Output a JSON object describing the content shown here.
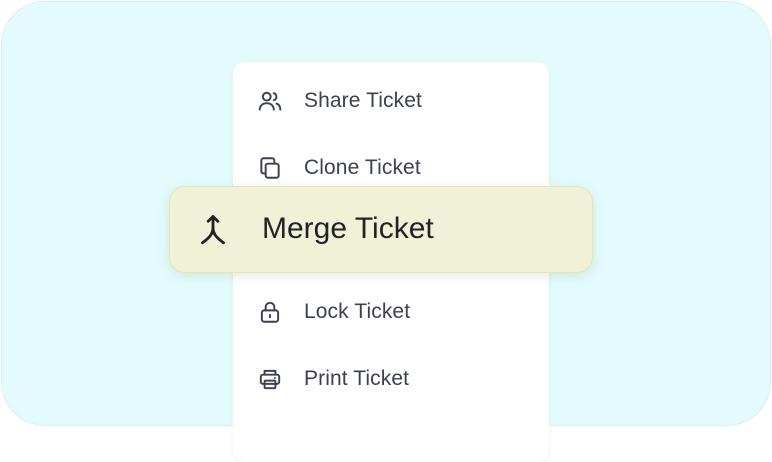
{
  "menu": {
    "items": [
      {
        "id": "share",
        "label": "Share Ticket",
        "icon": "users-icon"
      },
      {
        "id": "clone",
        "label": "Clone Ticket",
        "icon": "copy-icon"
      },
      {
        "id": "lock",
        "label": "Lock Ticket",
        "icon": "lock-icon"
      },
      {
        "id": "print",
        "label": "Print Ticket",
        "icon": "printer-icon"
      }
    ],
    "highlighted": {
      "id": "merge",
      "label": "Merge Ticket",
      "icon": "merge-icon"
    }
  },
  "colors": {
    "background": "#e3fbfd",
    "menu": "#ffffff",
    "highlight": "#f1f1d7",
    "text": "#3c4152"
  }
}
